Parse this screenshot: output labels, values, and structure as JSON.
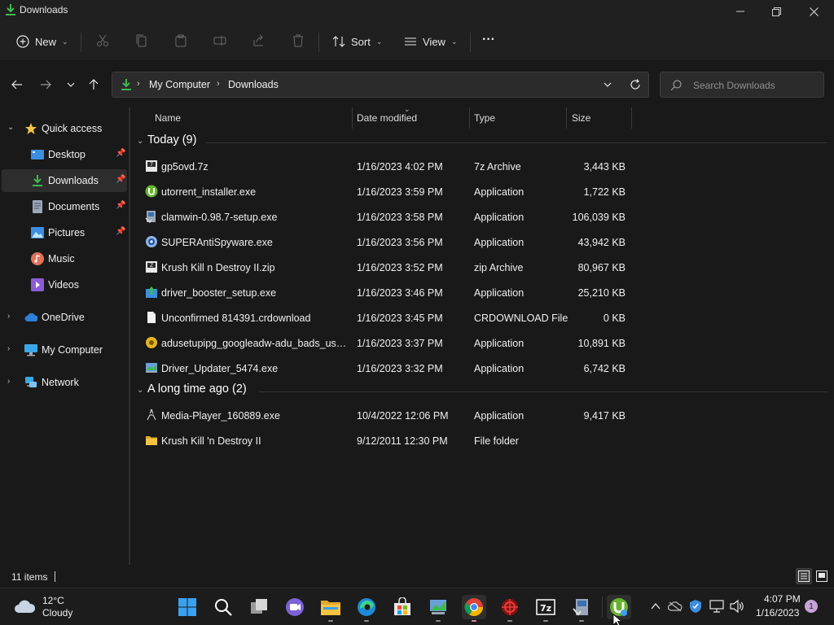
{
  "window": {
    "title": "Downloads",
    "controls": {
      "minimize": "—",
      "maximize": "❐",
      "close": "✕"
    }
  },
  "commandbar": {
    "new_label": "New",
    "sort_label": "Sort",
    "view_label": "View",
    "more_label": "···"
  },
  "addressbar": {
    "crumbs": [
      "My Computer",
      "Downloads"
    ],
    "separator": "›"
  },
  "search": {
    "placeholder": "Search Downloads"
  },
  "sidebar": {
    "items": [
      {
        "label": "Quick access",
        "icon": "star-icon"
      },
      {
        "label": "Desktop",
        "icon": "desktop-icon",
        "pinned": true
      },
      {
        "label": "Downloads",
        "icon": "download-icon",
        "pinned": true,
        "selected": true
      },
      {
        "label": "Documents",
        "icon": "documents-icon",
        "pinned": true
      },
      {
        "label": "Pictures",
        "icon": "pictures-icon",
        "pinned": true
      },
      {
        "label": "Music",
        "icon": "music-icon"
      },
      {
        "label": "Videos",
        "icon": "videos-icon"
      },
      {
        "label": "OneDrive",
        "icon": "cloud-icon"
      },
      {
        "label": "My Computer",
        "icon": "computer-icon"
      },
      {
        "label": "Network",
        "icon": "network-icon"
      }
    ]
  },
  "columns": {
    "name": "Name",
    "date": "Date modified",
    "type": "Type",
    "size": "Size"
  },
  "groups": [
    {
      "label": "Today (9)",
      "files": [
        {
          "name": "gp5ovd.7z",
          "date": "1/16/2023 4:02 PM",
          "type": "7z Archive",
          "size": "3,443 KB",
          "icon": "archive-7z-icon"
        },
        {
          "name": "utorrent_installer.exe",
          "date": "1/16/2023 3:59 PM",
          "type": "Application",
          "size": "1,722 KB",
          "icon": "utorrent-icon"
        },
        {
          "name": "clamwin-0.98.7-setup.exe",
          "date": "1/16/2023 3:58 PM",
          "type": "Application",
          "size": "106,039 KB",
          "icon": "installer-icon"
        },
        {
          "name": "SUPERAntiSpyware.exe",
          "date": "1/16/2023 3:56 PM",
          "type": "Application",
          "size": "43,942 KB",
          "icon": "antispyware-icon"
        },
        {
          "name": "Krush Kill n Destroy II.zip",
          "date": "1/16/2023 3:52 PM",
          "type": "zip Archive",
          "size": "80,967 KB",
          "icon": "archive-zip-icon"
        },
        {
          "name": "driver_booster_setup.exe",
          "date": "1/16/2023 3:46 PM",
          "type": "Application",
          "size": "25,210 KB",
          "icon": "driver-booster-icon"
        },
        {
          "name": "Unconfirmed 814391.crdownload",
          "date": "1/16/2023 3:45 PM",
          "type": "CRDOWNLOAD File",
          "size": "0 KB",
          "icon": "blank-file-icon"
        },
        {
          "name": "adusetupipg_googleadw-adu_bads_usa_...",
          "date": "1/16/2023 3:37 PM",
          "type": "Application",
          "size": "10,891 KB",
          "icon": "setup-icon"
        },
        {
          "name": "Driver_Updater_5474.exe",
          "date": "1/16/2023 3:32 PM",
          "type": "Application",
          "size": "6,742 KB",
          "icon": "driver-updater-icon"
        }
      ]
    },
    {
      "label": "A long time ago (2)",
      "files": [
        {
          "name": "Media-Player_160889.exe",
          "date": "10/4/2022 12:06 PM",
          "type": "Application",
          "size": "9,417 KB",
          "icon": "media-player-icon"
        },
        {
          "name": "Krush Kill 'n Destroy II",
          "date": "9/12/2011 12:30 PM",
          "type": "File folder",
          "size": "",
          "icon": "folder-icon"
        }
      ]
    }
  ],
  "status": {
    "item_count": "11 items"
  },
  "taskbar": {
    "weather": {
      "temp": "12°C",
      "condition": "Cloudy"
    },
    "apps": [
      "start-icon",
      "search-icon",
      "task-view-icon",
      "chat-icon",
      "file-explorer-icon",
      "edge-icon",
      "store-icon",
      "app-icon",
      "chrome-icon",
      "app-red-icon",
      "7zip-icon",
      "installer-app-icon",
      "utorrent-icon"
    ],
    "clock": {
      "time": "4:07 PM",
      "date": "1/16/2023"
    },
    "notification_count": "1"
  },
  "colors": {
    "accent_green": "#3fb950",
    "folder_yellow": "#f5c342",
    "selection": "#2d2d2d"
  }
}
